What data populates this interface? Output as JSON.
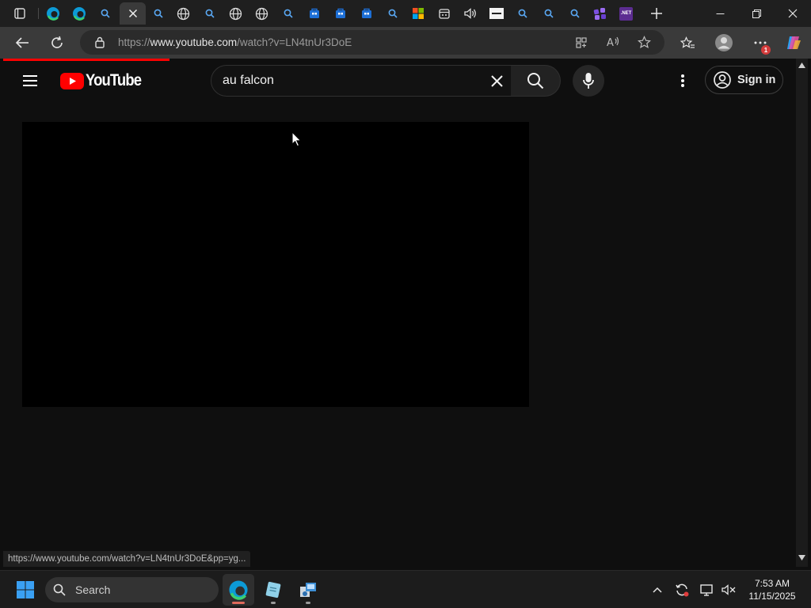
{
  "browser": {
    "url_prefix": "https://",
    "url_host": "www.youtube.com",
    "url_path": "/watch?v=LN4tnUr3DoE",
    "tabs": [
      {
        "icon": "tab-actions-icon"
      },
      {
        "icon": "edge-icon"
      },
      {
        "icon": "edge-icon"
      },
      {
        "icon": "bing-search-icon"
      },
      {
        "icon": "close-icon",
        "active": true
      },
      {
        "icon": "bing-search-icon"
      },
      {
        "icon": "globe-icon"
      },
      {
        "icon": "bing-search-icon"
      },
      {
        "icon": "globe-icon"
      },
      {
        "icon": "globe-icon"
      },
      {
        "icon": "bing-search-icon"
      },
      {
        "icon": "store-icon"
      },
      {
        "icon": "store-icon"
      },
      {
        "icon": "store-icon"
      },
      {
        "icon": "bing-search-icon"
      },
      {
        "icon": "microsoft-icon"
      },
      {
        "icon": "calendar-icon"
      },
      {
        "icon": "speaker-icon"
      },
      {
        "icon": "site-icon"
      },
      {
        "icon": "bing-search-icon"
      },
      {
        "icon": "bing-search-icon"
      },
      {
        "icon": "bing-search-icon"
      },
      {
        "icon": "apps-icon"
      },
      {
        "icon": "dotnet-icon"
      }
    ],
    "dotnet_label": ".NET",
    "profile_badge": "1"
  },
  "youtube": {
    "logo_text": "YouTube",
    "search_value": "au falcon",
    "sign_in_label": "Sign in",
    "progress_fraction": 0.21
  },
  "status_link": "https://www.youtube.com/watch?v=LN4tnUr3DoE&pp=yg...",
  "taskbar": {
    "search_label": "Search",
    "time": "7:53 AM",
    "date": "11/15/2025"
  },
  "colors": {
    "youtube_red": "#ff0000",
    "page_bg": "#0f0f0f",
    "chrome_bg": "#3a3a3a"
  }
}
